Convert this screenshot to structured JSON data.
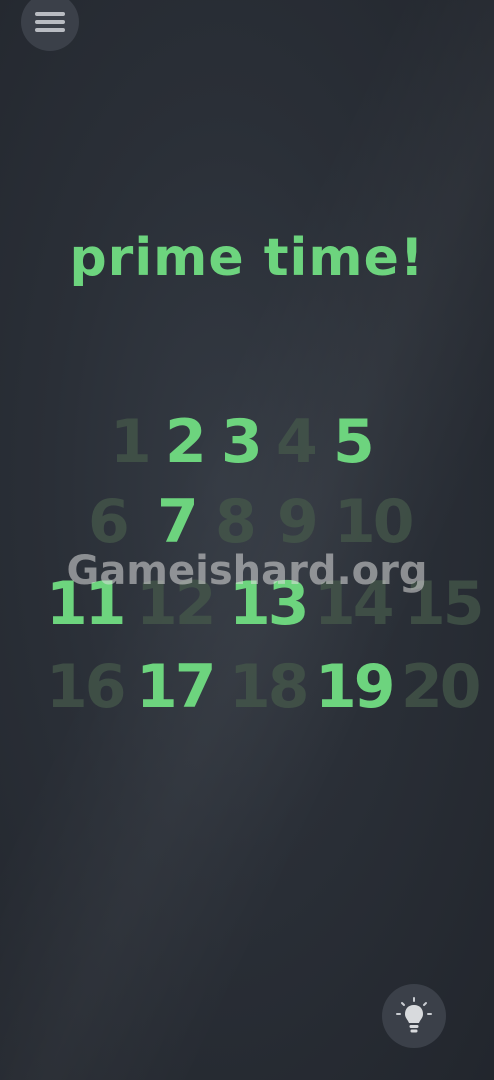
{
  "title": "prime time!",
  "numbers": [
    {
      "label": "1",
      "state": "dim"
    },
    {
      "label": "2",
      "state": "lit"
    },
    {
      "label": "3",
      "state": "lit"
    },
    {
      "label": "4",
      "state": "dim"
    },
    {
      "label": "5",
      "state": "lit"
    },
    {
      "label": "6",
      "state": "dim"
    },
    {
      "label": "7",
      "state": "lit"
    },
    {
      "label": "8",
      "state": "dim"
    },
    {
      "label": "9",
      "state": "dim"
    },
    {
      "label": "10",
      "state": "dim"
    },
    {
      "label": "11",
      "state": "lit"
    },
    {
      "label": "12",
      "state": "dim"
    },
    {
      "label": "13",
      "state": "lit"
    },
    {
      "label": "14",
      "state": "dim"
    },
    {
      "label": "15",
      "state": "dim"
    },
    {
      "label": "16",
      "state": "dim"
    },
    {
      "label": "17",
      "state": "lit"
    },
    {
      "label": "18",
      "state": "dim"
    },
    {
      "label": "19",
      "state": "lit"
    },
    {
      "label": "20",
      "state": "dim"
    }
  ],
  "watermark": "Gameishard.org",
  "icons": {
    "menu": "hamburger-menu-icon",
    "hint": "lightbulb-icon"
  },
  "colors": {
    "accent": "#6dd47e",
    "dim": "#45584a",
    "background": "#2a2f37",
    "button": "#3b4049"
  }
}
